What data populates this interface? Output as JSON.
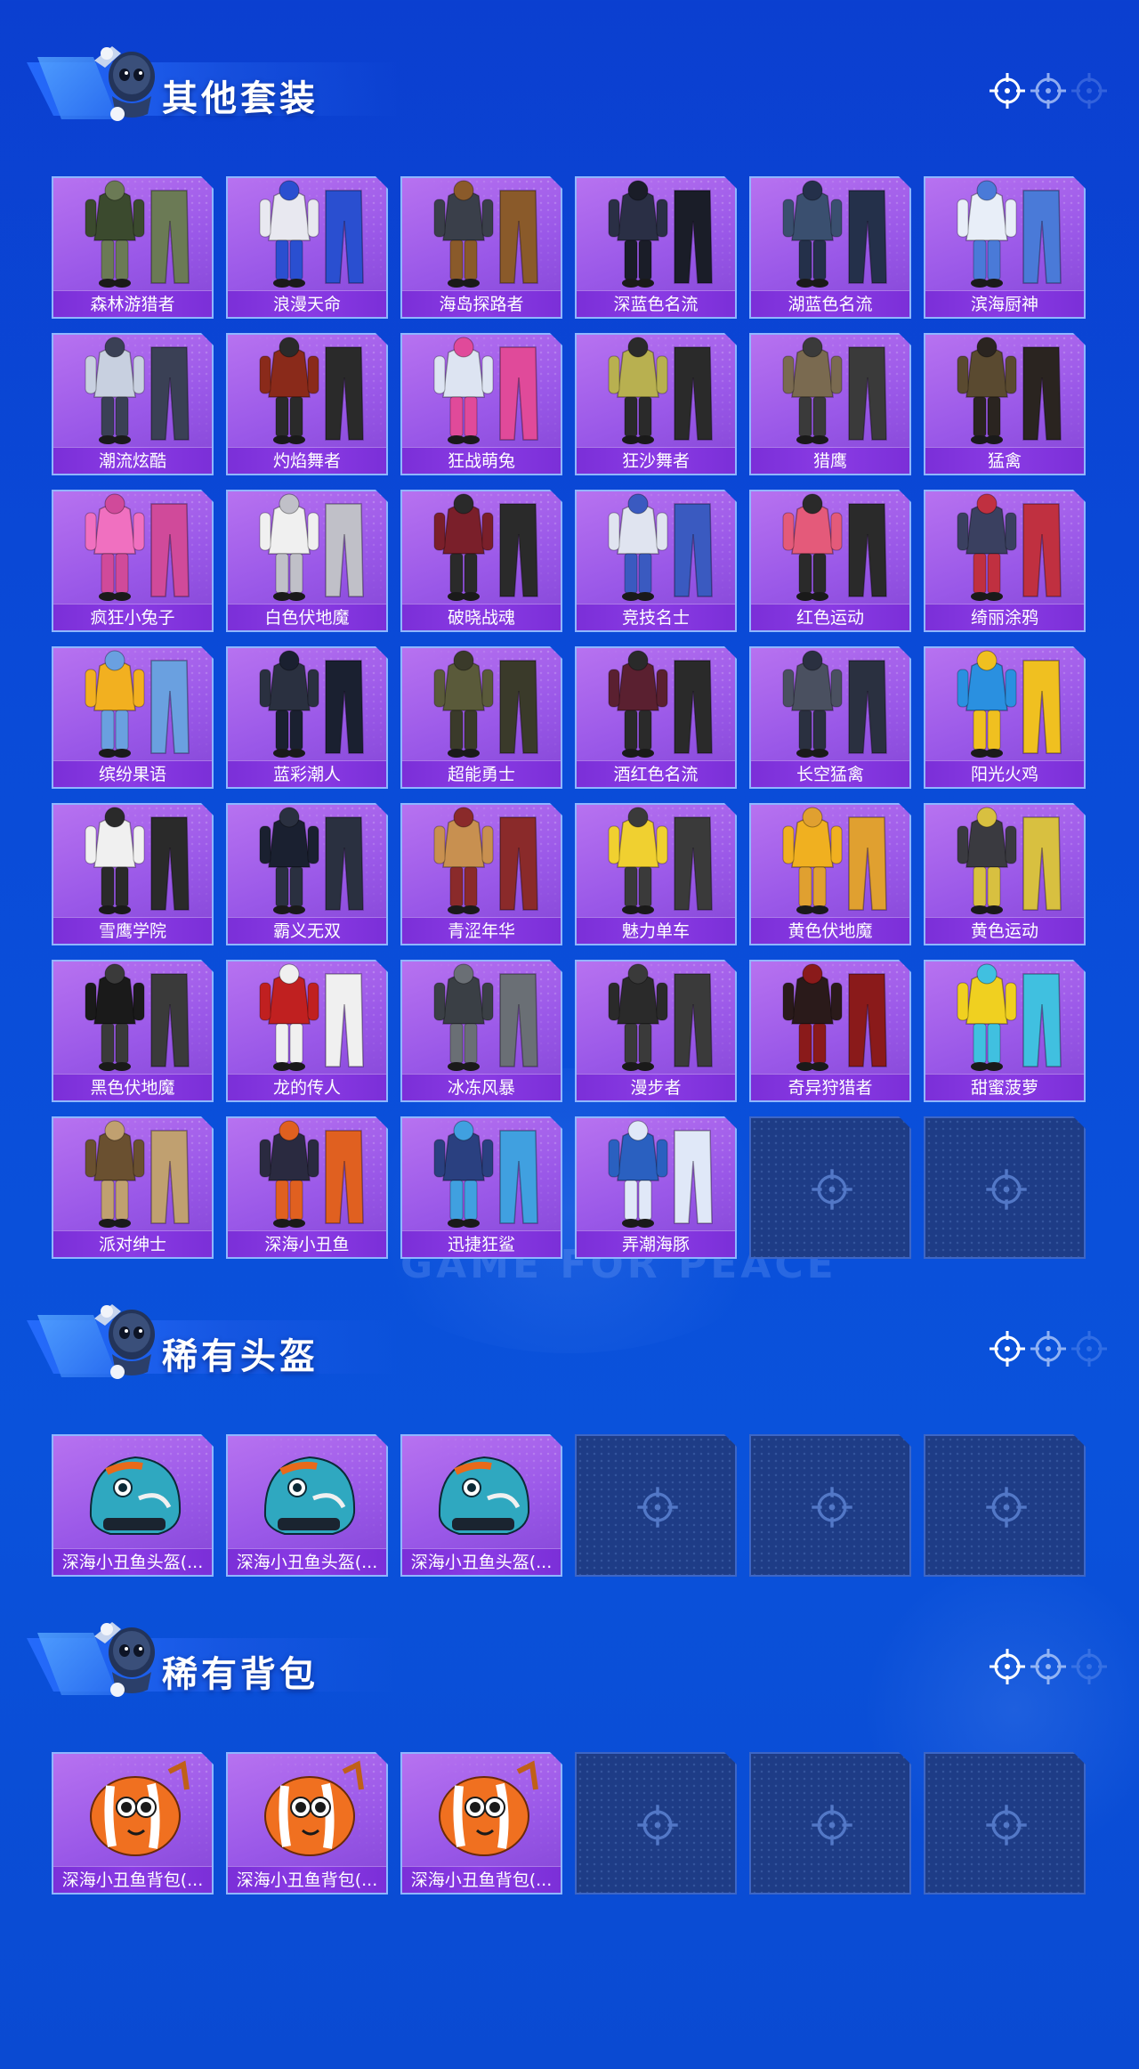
{
  "colors": {
    "background": "#0b47d6",
    "card_fill": "#9a58e8",
    "label_fill": "#8a3be4",
    "empty_fill": "#1e3c86",
    "card_border": "#8fb6ff"
  },
  "watermark": "GAME FOR PEACE",
  "sections": [
    {
      "title": "其他套装",
      "items": [
        "森林游猎者",
        "浪漫天命",
        "海岛探路者",
        "深蓝色名流",
        "湖蓝色名流",
        "滨海厨神",
        "潮流炫酷",
        "灼焰舞者",
        "狂战萌兔",
        "狂沙舞者",
        "猎鹰",
        "猛禽",
        "疯狂小兔子",
        "白色伏地魔",
        "破晓战魂",
        "竞技名士",
        "红色运动",
        "绮丽涂鸦",
        "缤纷果语",
        "蓝彩潮人",
        "超能勇士",
        "酒红色名流",
        "长空猛禽",
        "阳光火鸡",
        "雪鹰学院",
        "霸义无双",
        "青涩年华",
        "魅力单车",
        "黄色伏地魔",
        "黄色运动",
        "黑色伏地魔",
        "龙的传人",
        "冰冻风暴",
        "漫步者",
        "奇异狩猎者",
        "甜蜜菠萝",
        "派对绅士",
        "深海小丑鱼",
        "迅捷狂鲨",
        "弄潮海豚"
      ],
      "empty_slots": 2
    },
    {
      "title": "稀有头盔",
      "items": [
        "深海小丑鱼头盔(...",
        "深海小丑鱼头盔(...",
        "深海小丑鱼头盔(..."
      ],
      "empty_slots": 3
    },
    {
      "title": "稀有背包",
      "items": [
        "深海小丑鱼背包(...",
        "深海小丑鱼背包(...",
        "深海小丑鱼背包(..."
      ],
      "empty_slots": 3
    }
  ]
}
